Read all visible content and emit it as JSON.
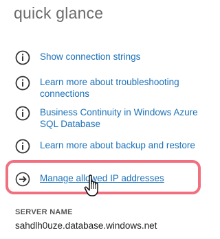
{
  "panel": {
    "title": "quick glance"
  },
  "links": [
    {
      "label": "Show connection strings",
      "icon": "info-icon"
    },
    {
      "label": "Learn more about troubleshooting connections",
      "icon": "info-icon"
    },
    {
      "label": "Business Continuity in Windows Azure SQL Database",
      "icon": "info-icon"
    },
    {
      "label": "Learn more about backup and restore",
      "icon": "info-icon"
    },
    {
      "label": "Manage allowed IP addresses",
      "icon": "arrow-right-icon"
    }
  ],
  "server": {
    "label": "SERVER NAME",
    "value": "sahdlh0uze.database.windows.net"
  },
  "colors": {
    "link": "#1a70b8",
    "title": "#6a6a6a",
    "highlight": "#f07080"
  }
}
